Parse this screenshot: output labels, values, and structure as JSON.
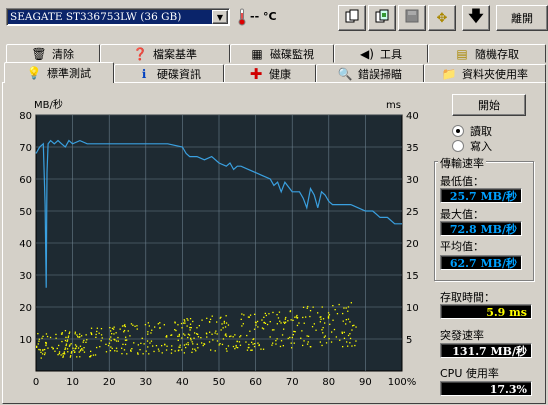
{
  "toolbar": {
    "drive": "SEAGATE ST336753LW (36 GB)",
    "temperature": "--",
    "temp_unit_icon": "thermometer-icon",
    "exit_label": "離開"
  },
  "tabs_row1": [
    {
      "label": "清除",
      "icon": "trash-icon"
    },
    {
      "label": "檔案基準",
      "icon": "file-bench-icon"
    },
    {
      "label": "磁碟監視",
      "icon": "disk-monitor-icon"
    },
    {
      "label": "工具",
      "icon": "speaker-icon"
    },
    {
      "label": "隨機存取",
      "icon": "random-access-icon"
    }
  ],
  "tabs_row2": [
    {
      "label": "標準測試",
      "icon": "lightbulb-icon"
    },
    {
      "label": "硬碟資訊",
      "icon": "info-icon"
    },
    {
      "label": "健康",
      "icon": "health-cross-icon"
    },
    {
      "label": "錯誤掃瞄",
      "icon": "magnifier-icon"
    },
    {
      "label": "資料夾使用率",
      "icon": "folder-icon"
    }
  ],
  "controls": {
    "start_label": "開始",
    "read_label": "讀取",
    "write_label": "寫入",
    "selected": "read"
  },
  "stats": {
    "transfer_title": "傳輸速率",
    "min_label": "最低值：",
    "min_value": "25.7 MB/秒",
    "max_label": "最大值：",
    "max_value": "72.8 MB/秒",
    "avg_label": "平均值：",
    "avg_value": "62.7 MB/秒",
    "access_label": "存取時間：",
    "access_value": "5.9 ms",
    "burst_label": "突發速率",
    "burst_value": "131.7 MB/秒",
    "cpu_label": "CPU 使用率",
    "cpu_value": "17.3%"
  },
  "chart_data": {
    "type": "line",
    "ylabel_left": "MB/秒",
    "ylabel_right": "ms",
    "y_left_ticks": [
      10,
      20,
      30,
      40,
      50,
      60,
      70,
      80
    ],
    "y_right_ticks": [
      5,
      10,
      15,
      20,
      25,
      30,
      35,
      40
    ],
    "x_ticks": [
      "0",
      "10",
      "20",
      "30",
      "40",
      "50",
      "60",
      "70",
      "80",
      "90",
      "100%"
    ],
    "xlim": [
      0,
      100
    ],
    "ylim_left": [
      0,
      80
    ],
    "ylim_right": [
      0,
      40
    ],
    "grid": true,
    "series": [
      {
        "color": "#3aa0e0",
        "x": [
          0,
          1,
          2,
          2.5,
          2.8,
          3,
          3.3,
          4,
          5,
          6,
          7,
          8,
          9,
          10,
          12,
          14,
          18,
          24,
          30,
          36,
          40,
          41,
          42,
          44,
          46,
          48,
          50,
          52,
          53,
          54,
          55,
          56,
          58,
          60,
          62,
          64,
          65,
          66,
          67,
          68,
          70,
          72,
          73,
          74,
          75,
          76,
          77,
          78,
          79,
          80,
          81,
          82,
          84,
          86,
          88,
          90,
          92,
          93,
          94,
          95,
          96,
          98,
          100
        ],
        "y": [
          68,
          70,
          71,
          52,
          26,
          62,
          71,
          72,
          71,
          72,
          71,
          70,
          72,
          71,
          72,
          71,
          71,
          71,
          71,
          71,
          70,
          68,
          67,
          67,
          66,
          67,
          65,
          64,
          65,
          63,
          64,
          64,
          63,
          62,
          61,
          60,
          58,
          59,
          56,
          59,
          56,
          56,
          54,
          51,
          57,
          55,
          51,
          56,
          55,
          53,
          52,
          52,
          52,
          52,
          51,
          50,
          50,
          49,
          48,
          48,
          48,
          46,
          46
        ]
      }
    ],
    "access_scatter": {
      "color": "#ffff00",
      "unit": "ms",
      "range_start_ms": [
        2,
        6
      ],
      "range_end_ms": [
        4,
        11
      ]
    }
  }
}
